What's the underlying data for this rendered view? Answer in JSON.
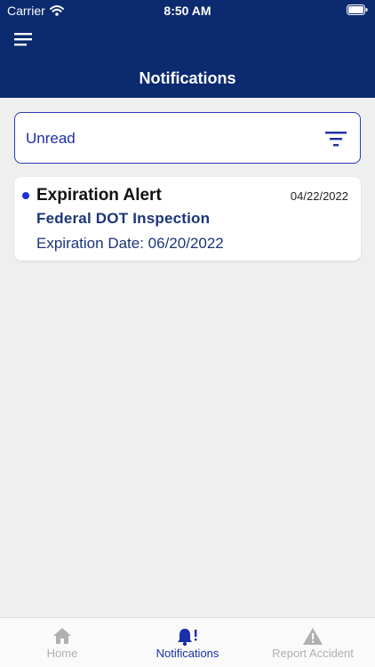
{
  "status_bar": {
    "carrier": "Carrier",
    "time": "8:50 AM"
  },
  "header": {
    "title": "Notifications"
  },
  "filter": {
    "selected": "Unread"
  },
  "notifications": [
    {
      "title": "Expiration Alert",
      "date": "04/22/2022",
      "subtitle": "Federal DOT Inspection",
      "detail": "Expiration Date: 06/20/2022",
      "unread": true
    }
  ],
  "tabs": [
    {
      "label": "Home",
      "icon": "home-icon",
      "active": false
    },
    {
      "label": "Notifications",
      "icon": "bell-icon",
      "active": true
    },
    {
      "label": "Report Accident",
      "icon": "warning-icon",
      "active": false
    }
  ],
  "colors": {
    "header_bg": "#0b2a6f",
    "accent": "#1c2fa8",
    "unread_dot": "#1a2fd8",
    "inactive_tab": "#b0b0b0",
    "page_bg": "#efefef"
  }
}
